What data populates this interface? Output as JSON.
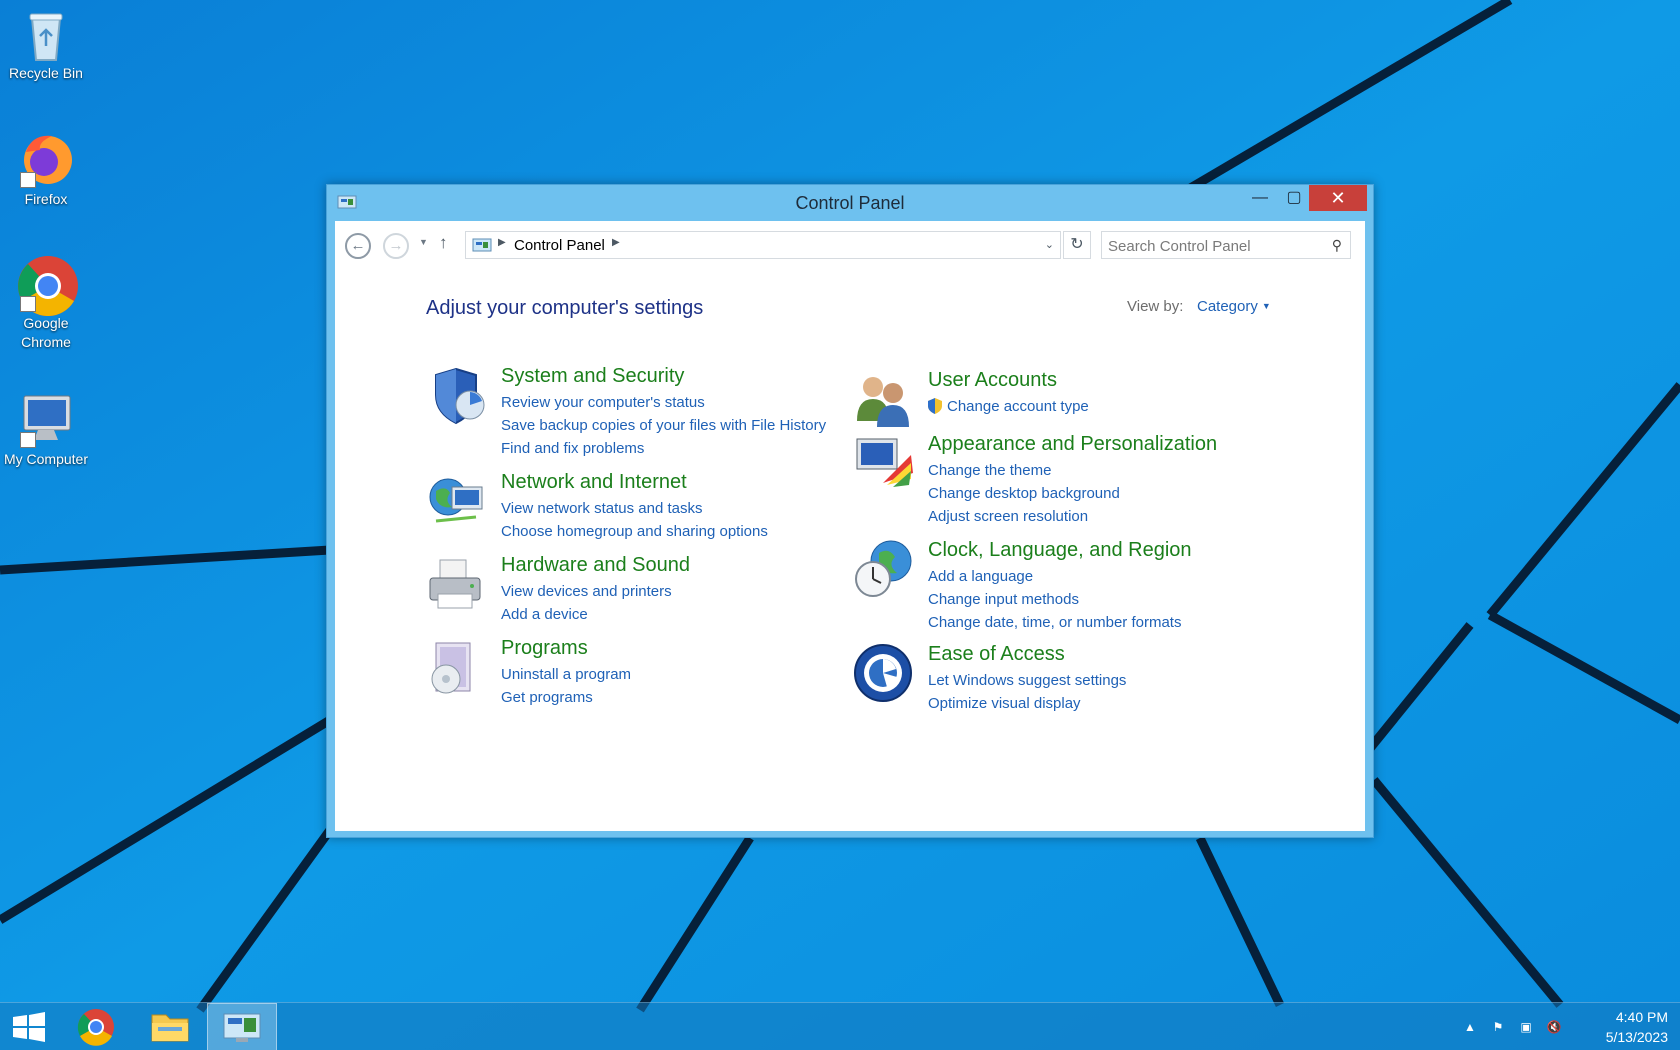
{
  "desktop": {
    "icons": [
      {
        "label": "Recycle Bin",
        "icon": "recycle-bin-icon"
      },
      {
        "label": "Firefox",
        "icon": "firefox-icon"
      },
      {
        "label": "Google Chrome",
        "icon": "chrome-icon"
      },
      {
        "label": "My Computer",
        "icon": "computer-icon"
      }
    ]
  },
  "window": {
    "title": "Control Panel",
    "controls": {
      "minimize": "minimize-icon",
      "maximize": "maximize-icon",
      "close": "close-icon"
    },
    "address_crumb": "Control Panel",
    "search_placeholder": "Search Control Panel",
    "heading": "Adjust your computer's settings",
    "view_by_label": "View by:",
    "view_by_value": "Category",
    "categories": [
      {
        "title": "System and Security",
        "icon": "shield-icon",
        "links": [
          "Review your computer's status",
          "Save backup copies of your files with File History",
          "Find and fix problems"
        ]
      },
      {
        "title": "Network and Internet",
        "icon": "network-globe-icon",
        "links": [
          "View network status and tasks",
          "Choose homegroup and sharing options"
        ]
      },
      {
        "title": "Hardware and Sound",
        "icon": "printer-icon",
        "links": [
          "View devices and printers",
          "Add a device"
        ]
      },
      {
        "title": "Programs",
        "icon": "programs-icon",
        "links": [
          "Uninstall a program",
          "Get programs"
        ]
      },
      {
        "title": "User Accounts",
        "icon": "users-icon",
        "links": [
          "Change account type"
        ]
      },
      {
        "title": "Appearance and Personalization",
        "icon": "display-palette-icon",
        "links": [
          "Change the theme",
          "Change desktop background",
          "Adjust screen resolution"
        ]
      },
      {
        "title": "Clock, Language, and Region",
        "icon": "clock-globe-icon",
        "links": [
          "Add a language",
          "Change input methods",
          "Change date, time, or number formats"
        ]
      },
      {
        "title": "Ease of Access",
        "icon": "ease-of-access-icon",
        "links": [
          "Let Windows suggest settings",
          "Optimize visual display"
        ]
      }
    ]
  },
  "taskbar": {
    "items": [
      "windows-start-icon",
      "chrome-icon",
      "file-explorer-icon",
      "control-panel-icon"
    ],
    "tray": [
      "show-hidden-icons-chevron",
      "action-center-flag-icon",
      "network-icon",
      "volume-muted-icon"
    ],
    "time": "4:40 PM",
    "date": "5/13/2023"
  },
  "colors": {
    "wallpaper": "#0a8fe0",
    "title_bar": "#6ec1ef",
    "close_button": "#c8403a",
    "category_title": "#1b7f1b",
    "link": "#1f61b6",
    "heading": "#1e3287"
  }
}
